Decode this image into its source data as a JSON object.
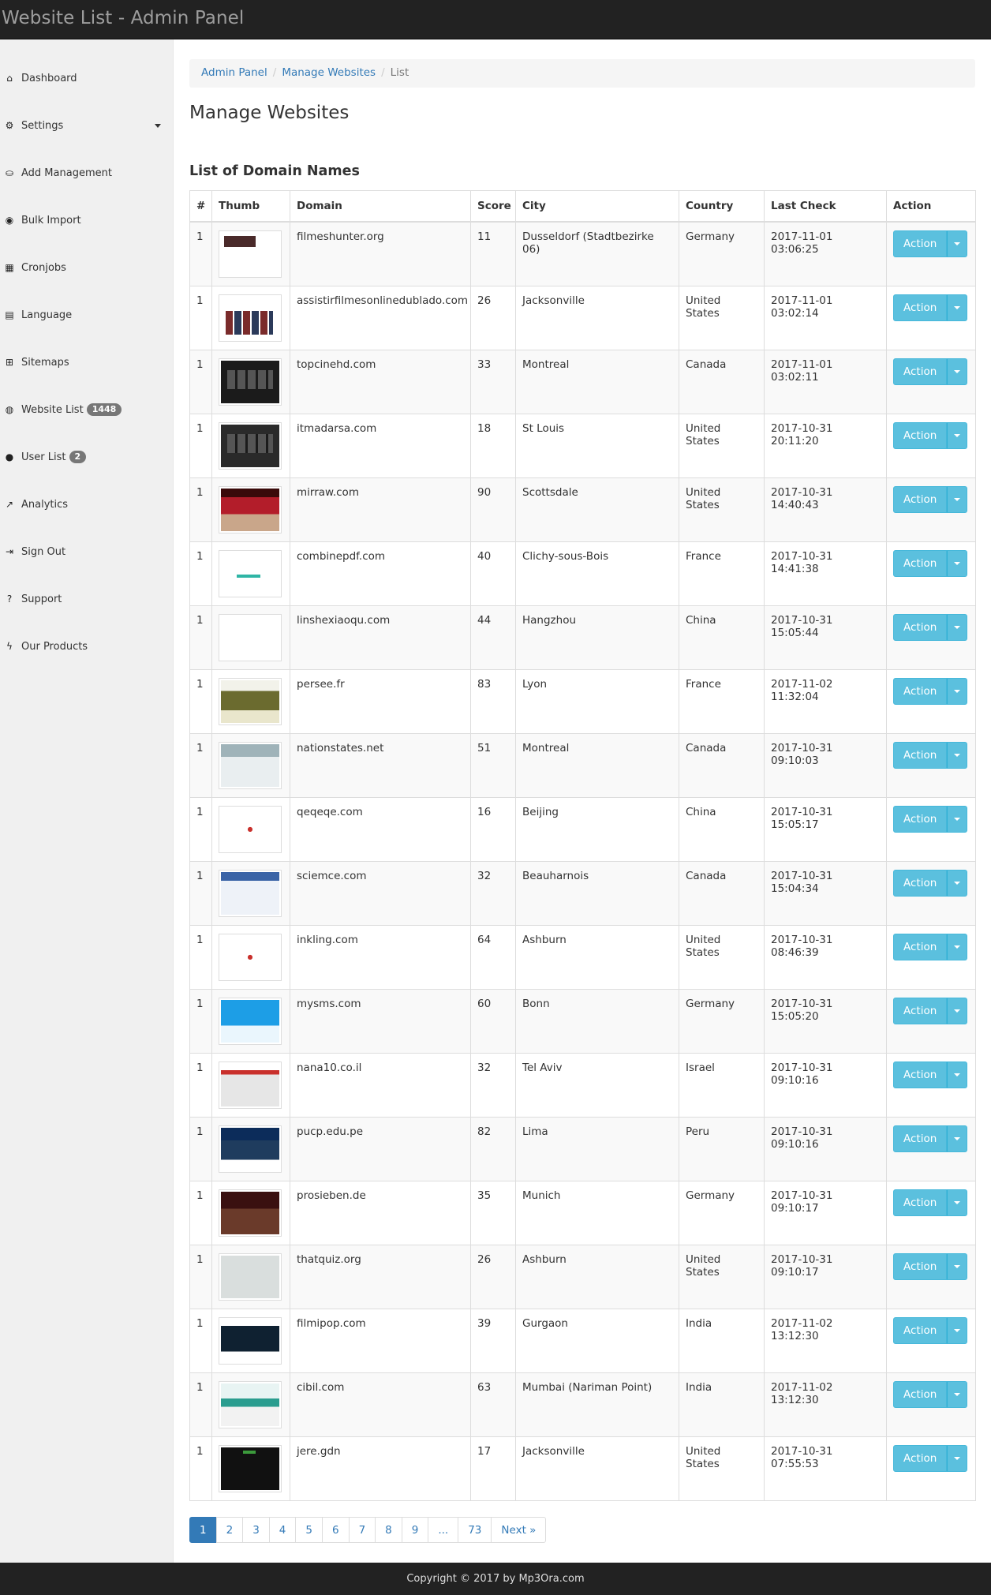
{
  "app": {
    "title": "Website List - Admin Panel"
  },
  "sidebar": {
    "items": [
      {
        "id": "dashboard",
        "icon": "home-icon",
        "glyph": "⌂",
        "label": "Dashboard",
        "badge": ""
      },
      {
        "id": "settings",
        "icon": "gear-icon",
        "glyph": "⚙",
        "label": "Settings",
        "badge": "",
        "dropdown": true
      },
      {
        "id": "add-management",
        "icon": "basket-icon",
        "glyph": "⛀",
        "label": "Add Management",
        "badge": ""
      },
      {
        "id": "bulk-import",
        "icon": "import-icon",
        "glyph": "◉",
        "label": "Bulk Import",
        "badge": ""
      },
      {
        "id": "cronjobs",
        "icon": "calendar-icon",
        "glyph": "▦",
        "label": "Cronjobs",
        "badge": ""
      },
      {
        "id": "language",
        "icon": "language-icon",
        "glyph": "▤",
        "label": "Language",
        "badge": ""
      },
      {
        "id": "sitemaps",
        "icon": "sitemap-icon",
        "glyph": "⊞",
        "label": "Sitemaps",
        "badge": ""
      },
      {
        "id": "website-list",
        "icon": "globe-icon",
        "glyph": "◍",
        "label": "Website List",
        "badge": "1448"
      },
      {
        "id": "user-list",
        "icon": "user-icon",
        "glyph": "●",
        "label": "User List",
        "badge": "2"
      },
      {
        "id": "analytics",
        "icon": "line-chart-icon",
        "glyph": "↗",
        "label": "Analytics",
        "badge": ""
      },
      {
        "id": "sign-out",
        "icon": "sign-out-icon",
        "glyph": "⇥",
        "label": "Sign Out",
        "badge": ""
      },
      {
        "id": "support",
        "icon": "question-icon",
        "glyph": "?",
        "label": "Support",
        "badge": ""
      },
      {
        "id": "our-products",
        "icon": "bolt-icon",
        "glyph": "ϟ",
        "label": "Our Products",
        "badge": ""
      }
    ]
  },
  "breadcrumb": {
    "home": "Admin Panel",
    "section": "Manage Websites",
    "current": "List",
    "separator": "/"
  },
  "page": {
    "title": "Manage Websites",
    "subtitle": "List of Domain Names"
  },
  "table": {
    "headers": [
      "#",
      "Thumb",
      "Domain",
      "Score",
      "City",
      "Country",
      "Last Check",
      "Action"
    ],
    "action_label": "Action",
    "rows": [
      {
        "num": "1",
        "domain": "filmeshunter.org",
        "score": "11",
        "city": "Dusseldorf (Stadtbezirke 06)",
        "country": "Germany",
        "last_check": "2017-11-01 03:06:25",
        "thumb": "light"
      },
      {
        "num": "1",
        "domain": "assistirfilmesonlinedublado.com",
        "score": "26",
        "city": "Jacksonville",
        "country": "United States",
        "last_check": "2017-11-01 03:02:14",
        "thumb": "posters"
      },
      {
        "num": "1",
        "domain": "topcinehd.com",
        "score": "33",
        "city": "Montreal",
        "country": "Canada",
        "last_check": "2017-11-01 03:02:11",
        "thumb": "dark"
      },
      {
        "num": "1",
        "domain": "itmadarsa.com",
        "score": "18",
        "city": "St Louis",
        "country": "United States",
        "last_check": "2017-10-31 20:11:20",
        "thumb": "darkgrey"
      },
      {
        "num": "1",
        "domain": "mirraw.com",
        "score": "90",
        "city": "Scottsdale",
        "country": "United States",
        "last_check": "2017-10-31 14:40:43",
        "thumb": "red"
      },
      {
        "num": "1",
        "domain": "combinepdf.com",
        "score": "40",
        "city": "Clichy-sous-Bois",
        "country": "France",
        "last_check": "2017-10-31 14:41:38",
        "thumb": "white-teal"
      },
      {
        "num": "1",
        "domain": "linshexiaoqu.com",
        "score": "44",
        "city": "Hangzhou",
        "country": "China",
        "last_check": "2017-10-31 15:05:44",
        "thumb": "blank"
      },
      {
        "num": "1",
        "domain": "persee.fr",
        "score": "83",
        "city": "Lyon",
        "country": "France",
        "last_check": "2017-11-02 11:32:04",
        "thumb": "olive"
      },
      {
        "num": "1",
        "domain": "nationstates.net",
        "score": "51",
        "city": "Montreal",
        "country": "Canada",
        "last_check": "2017-10-31 09:10:03",
        "thumb": "greyish"
      },
      {
        "num": "1",
        "domain": "qeqeqe.com",
        "score": "16",
        "city": "Beijing",
        "country": "China",
        "last_check": "2017-10-31 15:05:17",
        "thumb": "pagepeeker"
      },
      {
        "num": "1",
        "domain": "sciemce.com",
        "score": "32",
        "city": "Beauharnois",
        "country": "Canada",
        "last_check": "2017-10-31 15:04:34",
        "thumb": "bluish"
      },
      {
        "num": "1",
        "domain": "inkling.com",
        "score": "64",
        "city": "Ashburn",
        "country": "United States",
        "last_check": "2017-10-31 08:46:39",
        "thumb": "pagepeeker"
      },
      {
        "num": "1",
        "domain": "mysms.com",
        "score": "60",
        "city": "Bonn",
        "country": "Germany",
        "last_check": "2017-10-31 15:05:20",
        "thumb": "cyan"
      },
      {
        "num": "1",
        "domain": "nana10.co.il",
        "score": "32",
        "city": "Tel Aviv",
        "country": "Israel",
        "last_check": "2017-10-31 09:10:16",
        "thumb": "news"
      },
      {
        "num": "1",
        "domain": "pucp.edu.pe",
        "score": "82",
        "city": "Lima",
        "country": "Peru",
        "last_check": "2017-10-31 09:10:16",
        "thumb": "navy"
      },
      {
        "num": "1",
        "domain": "prosieben.de",
        "score": "35",
        "city": "Munich",
        "country": "Germany",
        "last_check": "2017-10-31 09:10:17",
        "thumb": "darkred"
      },
      {
        "num": "1",
        "domain": "thatquiz.org",
        "score": "26",
        "city": "Ashburn",
        "country": "United States",
        "last_check": "2017-10-31 09:10:17",
        "thumb": "quiz"
      },
      {
        "num": "1",
        "domain": "filmipop.com",
        "score": "39",
        "city": "Gurgaon",
        "country": "India",
        "last_check": "2017-11-02 13:12:30",
        "thumb": "movie"
      },
      {
        "num": "1",
        "domain": "cibil.com",
        "score": "63",
        "city": "Mumbai (Nariman Point)",
        "country": "India",
        "last_check": "2017-11-02 13:12:30",
        "thumb": "teal"
      },
      {
        "num": "1",
        "domain": "jere.gdn",
        "score": "17",
        "city": "Jacksonville",
        "country": "United States",
        "last_check": "2017-10-31 07:55:53",
        "thumb": "black"
      }
    ]
  },
  "pagination": {
    "pages": [
      "1",
      "2",
      "3",
      "4",
      "5",
      "6",
      "7",
      "8",
      "9",
      "...",
      "73",
      "Next »"
    ],
    "active": "1"
  },
  "footer": {
    "text": "Copyright © 2017 by Mp3Ora.com"
  },
  "colors": {
    "topbar": "#222222",
    "sidebar": "#f0f0f0",
    "link": "#337ab7",
    "info_button": "#5bc0de",
    "active_page": "#337ab7"
  }
}
